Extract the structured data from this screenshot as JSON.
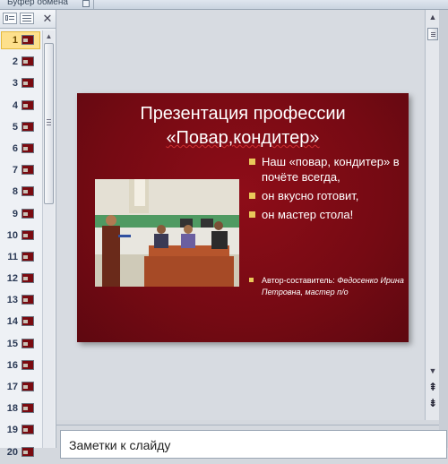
{
  "ribbon": {
    "group_label": "Буфер обмена"
  },
  "slides_panel": {
    "tabs": [
      "slides-tab",
      "outline-tab"
    ],
    "close_glyph": "✕",
    "selected": 1,
    "slide_numbers": [
      "1",
      "2",
      "3",
      "4",
      "5",
      "6",
      "7",
      "8",
      "9",
      "10",
      "11",
      "12",
      "13",
      "14",
      "15",
      "16",
      "17",
      "18",
      "19",
      "20"
    ]
  },
  "slide": {
    "title_line1": "Презентация профессии",
    "title_line2": "«Повар,кондитер»",
    "bullets": [
      "Наш  «повар, кондитер» в почёте всегда,",
      "он вкусно готовит,",
      "он мастер стола!"
    ],
    "author_label": "Автор-составитель: ",
    "author_name": "Федосенко Ирина Петровна, мастер п/о",
    "colors": {
      "background": "#750a13",
      "bullet": "#e9c85a",
      "text": "#ffffff"
    }
  },
  "scrollbar": {
    "up_glyph": "▲",
    "down_glyph": "▼",
    "prev_slide_glyph": "⇞",
    "next_slide_glyph": "⇟"
  },
  "notes": {
    "placeholder": "Заметки к слайду"
  }
}
